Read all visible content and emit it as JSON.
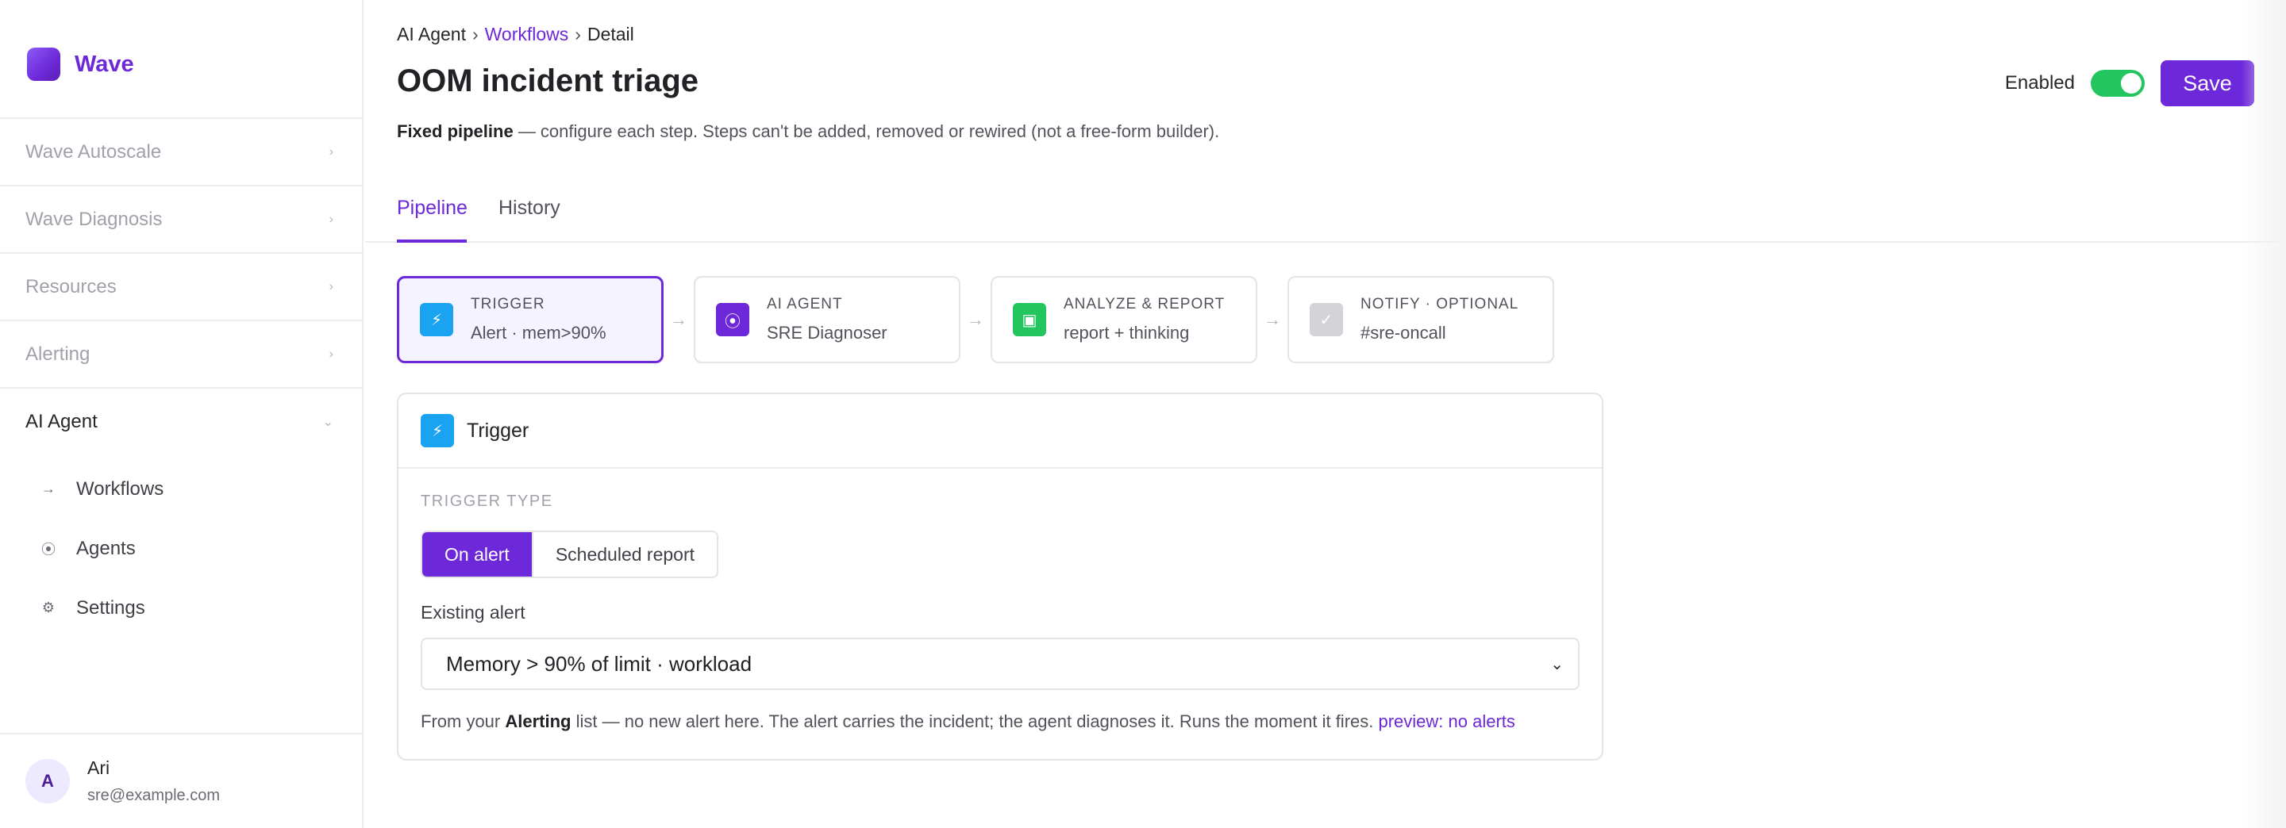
{
  "brand": {
    "name": "Wave"
  },
  "sidebar": {
    "items": [
      {
        "label": "Wave Autoscale"
      },
      {
        "label": "Wave Diagnosis"
      },
      {
        "label": "Resources"
      },
      {
        "label": "Alerting"
      },
      {
        "label": "AI Agent"
      }
    ],
    "subitems": [
      {
        "label": "Workflows",
        "icon": "→"
      },
      {
        "label": "Agents",
        "icon": "⦿"
      },
      {
        "label": "Settings",
        "icon": "⚙"
      }
    ]
  },
  "user": {
    "initial": "A",
    "name": "Ari",
    "email": "sre@example.com"
  },
  "breadcrumb": {
    "root": "AI Agent",
    "sep": "›",
    "section": "Workflows",
    "current": "Detail"
  },
  "header": {
    "title": "OOM incident triage",
    "subtitle_bold": "Fixed pipeline",
    "subtitle_rest": " — configure each step. Steps can't be added, removed or rewired (not a free-form builder).",
    "enabled_label": "Enabled",
    "enabled": true,
    "save_label": "Save"
  },
  "tabs": [
    {
      "label": "Pipeline"
    },
    {
      "label": "History"
    }
  ],
  "pipeline": {
    "steps": [
      {
        "kind": "TRIGGER",
        "value": "Alert · mem>90%",
        "icon": "⚡",
        "color": "#1aa3f0"
      },
      {
        "kind": "AI AGENT",
        "value": "SRE Diagnoser",
        "icon": "⦿",
        "color": "#6d28d9"
      },
      {
        "kind": "ANALYZE & REPORT",
        "value": "report + thinking",
        "icon": "▣",
        "color": "#22c55e"
      },
      {
        "kind": "NOTIFY · OPTIONAL",
        "value": "#sre-oncall",
        "icon": "✓",
        "color": "#d4d4d8"
      }
    ],
    "arrow": "→"
  },
  "trigger_card": {
    "title": "Trigger",
    "icon": "⚡",
    "section_label": "TRIGGER TYPE",
    "options": [
      {
        "label": "On alert"
      },
      {
        "label": "Scheduled report"
      }
    ],
    "selected_option": "On alert",
    "field_label": "Existing alert",
    "select_value": "Memory > 90% of limit · workload",
    "helper_prefix": "From your ",
    "helper_bold": "Alerting",
    "helper_rest": " list — no new alert here. The alert carries the incident; the agent diagnoses it. Runs the moment it fires. ",
    "helper_link": "preview: no alerts"
  },
  "colors": {
    "accent": "#6d28d9",
    "toggle_on": "#22c55e"
  }
}
